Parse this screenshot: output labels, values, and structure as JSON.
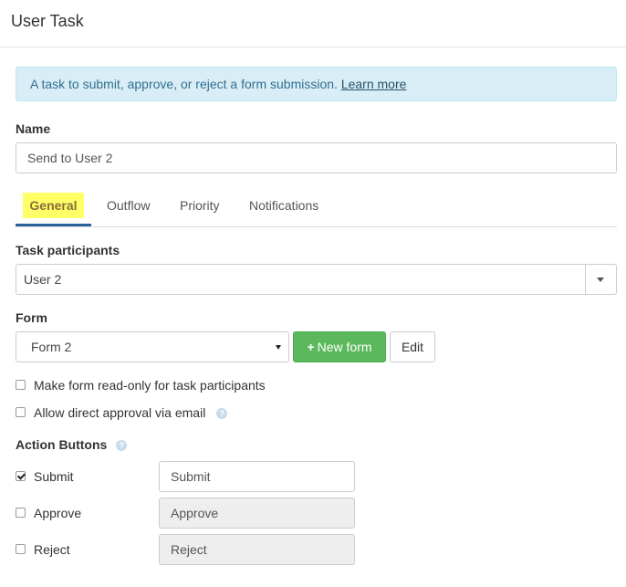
{
  "header": {
    "title": "User Task"
  },
  "info": {
    "text": "A task to submit, approve, or reject a form submission.",
    "link": "Learn more"
  },
  "name": {
    "label": "Name",
    "value": "Send to User 2"
  },
  "tabs": [
    {
      "label": "General",
      "active": true
    },
    {
      "label": "Outflow",
      "active": false
    },
    {
      "label": "Priority",
      "active": false
    },
    {
      "label": "Notifications",
      "active": false
    }
  ],
  "participants": {
    "label": "Task participants",
    "value": "User 2"
  },
  "form": {
    "label": "Form",
    "selected": "Form 2",
    "new_form_label": "New form",
    "edit_label": "Edit"
  },
  "options": {
    "read_only": {
      "label": "Make form read-only for task participants",
      "checked": false
    },
    "direct_approval": {
      "label": "Allow direct approval via email",
      "checked": false
    }
  },
  "action_buttons": {
    "label": "Action Buttons",
    "items": [
      {
        "label": "Submit",
        "checked": true,
        "value": "Submit"
      },
      {
        "label": "Approve",
        "checked": false,
        "value": "Approve"
      },
      {
        "label": "Reject",
        "checked": false,
        "value": "Reject"
      }
    ]
  },
  "colors": {
    "info_bg": "#d9edf7",
    "success": "#5cb85c",
    "tab_highlight": "#ffff66",
    "tab_underline": "#2a6496"
  },
  "icons": {
    "help": "question-circle-icon",
    "plus": "plus-icon",
    "caret": "caret-down-icon",
    "check": "check-icon"
  }
}
